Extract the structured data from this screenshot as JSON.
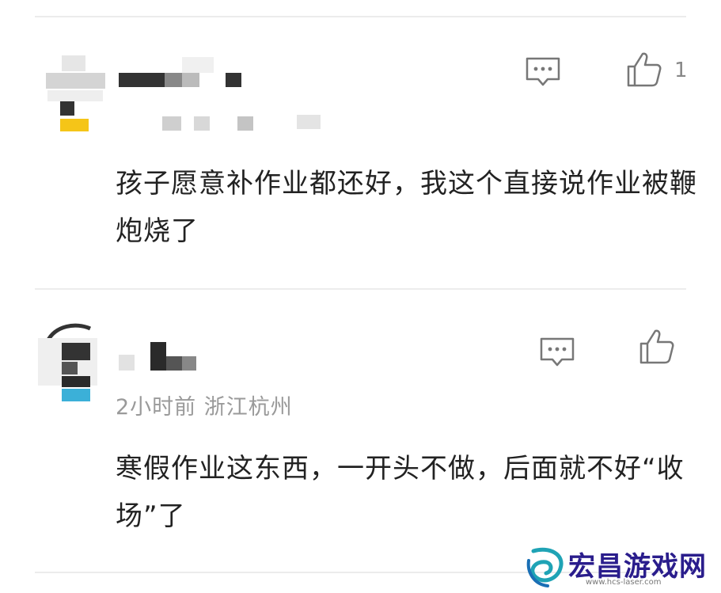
{
  "comments": [
    {
      "name": "",
      "meta": "",
      "text": "孩子愿意补作业都还好，我这个直接说作业被鞭炮烧了",
      "reply_icon": "comment-bubble-icon",
      "like_icon": "thumbs-up-icon",
      "like_count": "1"
    },
    {
      "name": "",
      "meta": "2小时前  浙江杭州",
      "text": "寒假作业这东西，一开头不做，后面就不好“收场”了",
      "reply_icon": "comment-bubble-icon",
      "like_icon": "thumbs-up-icon",
      "like_count": ""
    }
  ],
  "watermark": {
    "title": "宏昌游戏网",
    "url": "www.hcs-laser.com",
    "logo_icon": "swirl-logo-icon"
  },
  "colors": {
    "divider": "#ececec",
    "meta": "#9a9a9a",
    "icon": "#777777",
    "watermark_title": "#2a1d8c",
    "watermark_logo": "#1fa3b5"
  }
}
